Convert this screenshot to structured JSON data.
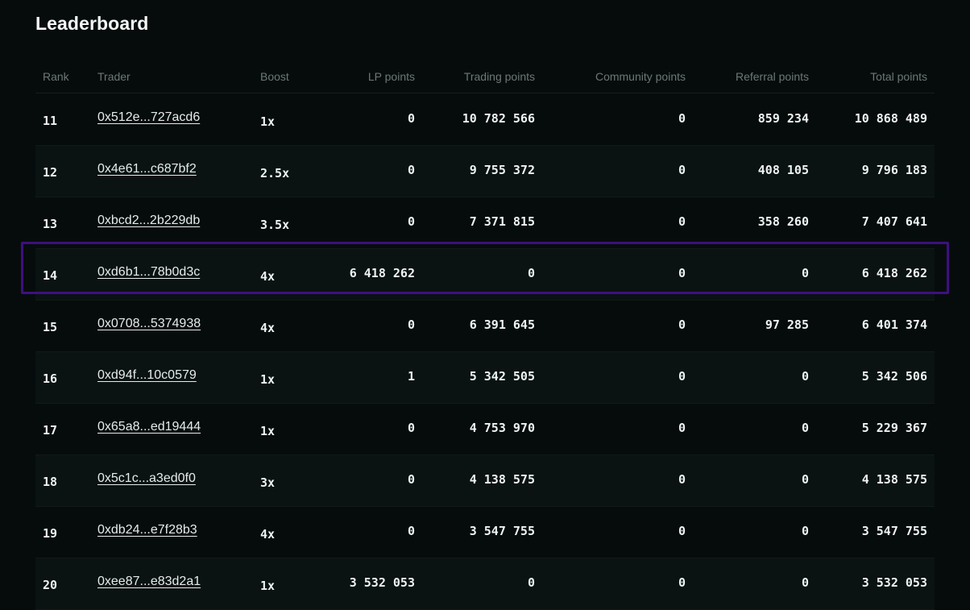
{
  "title": "Leaderboard",
  "colors": {
    "highlight": "#3f0f80",
    "background": "#060c0c"
  },
  "headers": {
    "rank": "Rank",
    "trader": "Trader",
    "boost": "Boost",
    "lp": "LP points",
    "trading": "Trading points",
    "community": "Community points",
    "referral": "Referral points",
    "total": "Total points"
  },
  "highlighted_rank": "14",
  "rows": [
    {
      "rank": "11",
      "trader": "0x512e...727acd6",
      "boost": "1x",
      "lp": "0",
      "trading": "10 782 566",
      "community": "0",
      "referral": "859 234",
      "total": "10 868 489"
    },
    {
      "rank": "12",
      "trader": "0x4e61...c687bf2",
      "boost": "2.5x",
      "lp": "0",
      "trading": "9 755 372",
      "community": "0",
      "referral": "408 105",
      "total": "9 796 183"
    },
    {
      "rank": "13",
      "trader": "0xbcd2...2b229db",
      "boost": "3.5x",
      "lp": "0",
      "trading": "7 371 815",
      "community": "0",
      "referral": "358 260",
      "total": "7 407 641"
    },
    {
      "rank": "14",
      "trader": "0xd6b1...78b0d3c",
      "boost": "4x",
      "lp": "6 418 262",
      "trading": "0",
      "community": "0",
      "referral": "0",
      "total": "6 418 262"
    },
    {
      "rank": "15",
      "trader": "0x0708...5374938",
      "boost": "4x",
      "lp": "0",
      "trading": "6 391 645",
      "community": "0",
      "referral": "97 285",
      "total": "6 401 374"
    },
    {
      "rank": "16",
      "trader": "0xd94f...10c0579",
      "boost": "1x",
      "lp": "1",
      "trading": "5 342 505",
      "community": "0",
      "referral": "0",
      "total": "5 342 506"
    },
    {
      "rank": "17",
      "trader": "0x65a8...ed19444",
      "boost": "1x",
      "lp": "0",
      "trading": "4 753 970",
      "community": "0",
      "referral": "0",
      "total": "5 229 367"
    },
    {
      "rank": "18",
      "trader": "0x5c1c...a3ed0f0",
      "boost": "3x",
      "lp": "0",
      "trading": "4 138 575",
      "community": "0",
      "referral": "0",
      "total": "4 138 575"
    },
    {
      "rank": "19",
      "trader": "0xdb24...e7f28b3",
      "boost": "4x",
      "lp": "0",
      "trading": "3 547 755",
      "community": "0",
      "referral": "0",
      "total": "3 547 755"
    },
    {
      "rank": "20",
      "trader": "0xee87...e83d2a1",
      "boost": "1x",
      "lp": "3 532 053",
      "trading": "0",
      "community": "0",
      "referral": "0",
      "total": "3 532 053"
    }
  ]
}
